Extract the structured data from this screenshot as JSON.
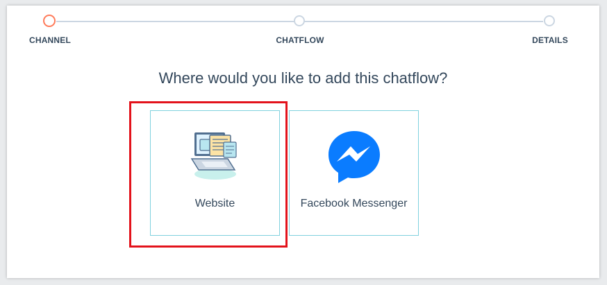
{
  "wizard": {
    "steps": [
      {
        "label": "CHANNEL",
        "state": "active"
      },
      {
        "label": "CHATFLOW",
        "state": "pending"
      },
      {
        "label": "DETAILS",
        "state": "pending"
      }
    ]
  },
  "main": {
    "question": "Where would you like to add this chatflow?",
    "options": [
      {
        "label": "Website",
        "icon": "website-laptop-icon",
        "highlighted": true
      },
      {
        "label": "Facebook Messenger",
        "icon": "facebook-messenger-icon",
        "highlighted": false
      }
    ]
  },
  "colors": {
    "accent_active": "#ff7a59",
    "track": "#cbd6e2",
    "card_border": "#7fd1de",
    "highlight": "#e3121b",
    "messenger_blue": "#0a7cff",
    "text": "#33475b"
  }
}
